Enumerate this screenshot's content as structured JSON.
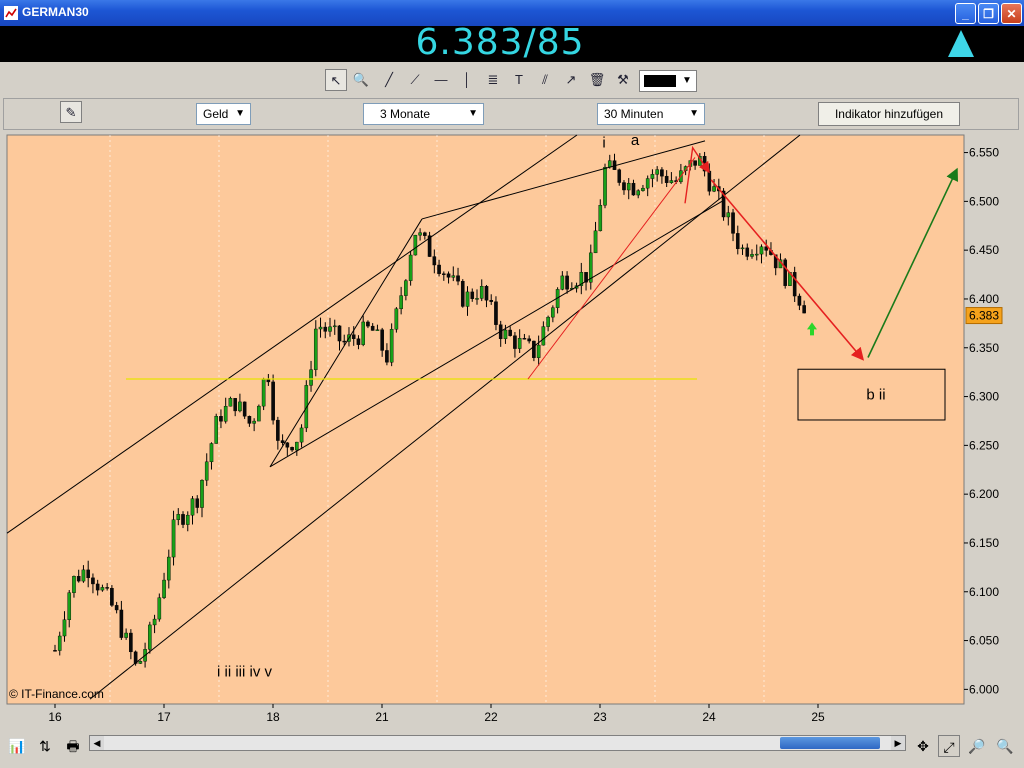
{
  "window": {
    "title": "GERMAN30"
  },
  "quote": {
    "price": "6.383/85",
    "trend": "up"
  },
  "toolbar": {
    "price_type": "Geld",
    "period": "3 Monate",
    "interval": "30 Minuten",
    "add_indicator": "Indikator hinzufügen"
  },
  "colors": {
    "background": "#fdc99b",
    "bull": "#19a019",
    "bear": "#0a0a0a",
    "annotation_red": "#e52020",
    "annotation_green": "#1a7a1a",
    "horizontal_line": "#e8e400"
  },
  "chart_data": {
    "type": "candlestick",
    "ylim": [
      5985,
      6568
    ],
    "y_ticks": [
      "6.550",
      "6.500",
      "6.450",
      "6.400",
      "6.350",
      "6.300",
      "6.250",
      "6.200",
      "6.150",
      "6.100",
      "6.050",
      "6.000"
    ],
    "x_ticks": [
      "16",
      "17",
      "18",
      "21",
      "22",
      "23",
      "24",
      "25"
    ],
    "last_price_label": "6.383",
    "copyright": "© IT-Finance.com",
    "annotations": {
      "wave_labels": "i ii iii iv v",
      "label_i": "i",
      "label_a": "a",
      "target_box": "b ii"
    },
    "close_path": [
      {
        "x": 0.0,
        "y": 6040
      },
      {
        "x": 0.15,
        "y": 6110
      },
      {
        "x": 0.3,
        "y": 6125
      },
      {
        "x": 0.55,
        "y": 6080
      },
      {
        "x": 0.75,
        "y": 6020
      },
      {
        "x": 0.9,
        "y": 6065
      },
      {
        "x": 1.1,
        "y": 6170
      },
      {
        "x": 1.3,
        "y": 6195
      },
      {
        "x": 1.5,
        "y": 6280
      },
      {
        "x": 1.65,
        "y": 6295
      },
      {
        "x": 1.8,
        "y": 6270
      },
      {
        "x": 1.95,
        "y": 6330
      },
      {
        "x": 2.05,
        "y": 6245
      },
      {
        "x": 2.25,
        "y": 6260
      },
      {
        "x": 2.4,
        "y": 6375
      },
      {
        "x": 2.65,
        "y": 6355
      },
      {
        "x": 2.9,
        "y": 6370
      },
      {
        "x": 3.05,
        "y": 6340
      },
      {
        "x": 3.3,
        "y": 6470
      },
      {
        "x": 3.5,
        "y": 6440
      },
      {
        "x": 3.75,
        "y": 6400
      },
      {
        "x": 3.9,
        "y": 6410
      },
      {
        "x": 4.1,
        "y": 6365
      },
      {
        "x": 4.4,
        "y": 6345
      },
      {
        "x": 4.65,
        "y": 6420
      },
      {
        "x": 4.9,
        "y": 6425
      },
      {
        "x": 5.05,
        "y": 6535
      },
      {
        "x": 5.3,
        "y": 6515
      },
      {
        "x": 5.5,
        "y": 6530
      },
      {
        "x": 5.7,
        "y": 6520
      },
      {
        "x": 5.9,
        "y": 6545
      },
      {
        "x": 6.05,
        "y": 6510
      },
      {
        "x": 6.3,
        "y": 6450
      },
      {
        "x": 6.5,
        "y": 6460
      },
      {
        "x": 6.75,
        "y": 6415
      },
      {
        "x": 6.9,
        "y": 6390
      }
    ]
  },
  "bottom": {}
}
